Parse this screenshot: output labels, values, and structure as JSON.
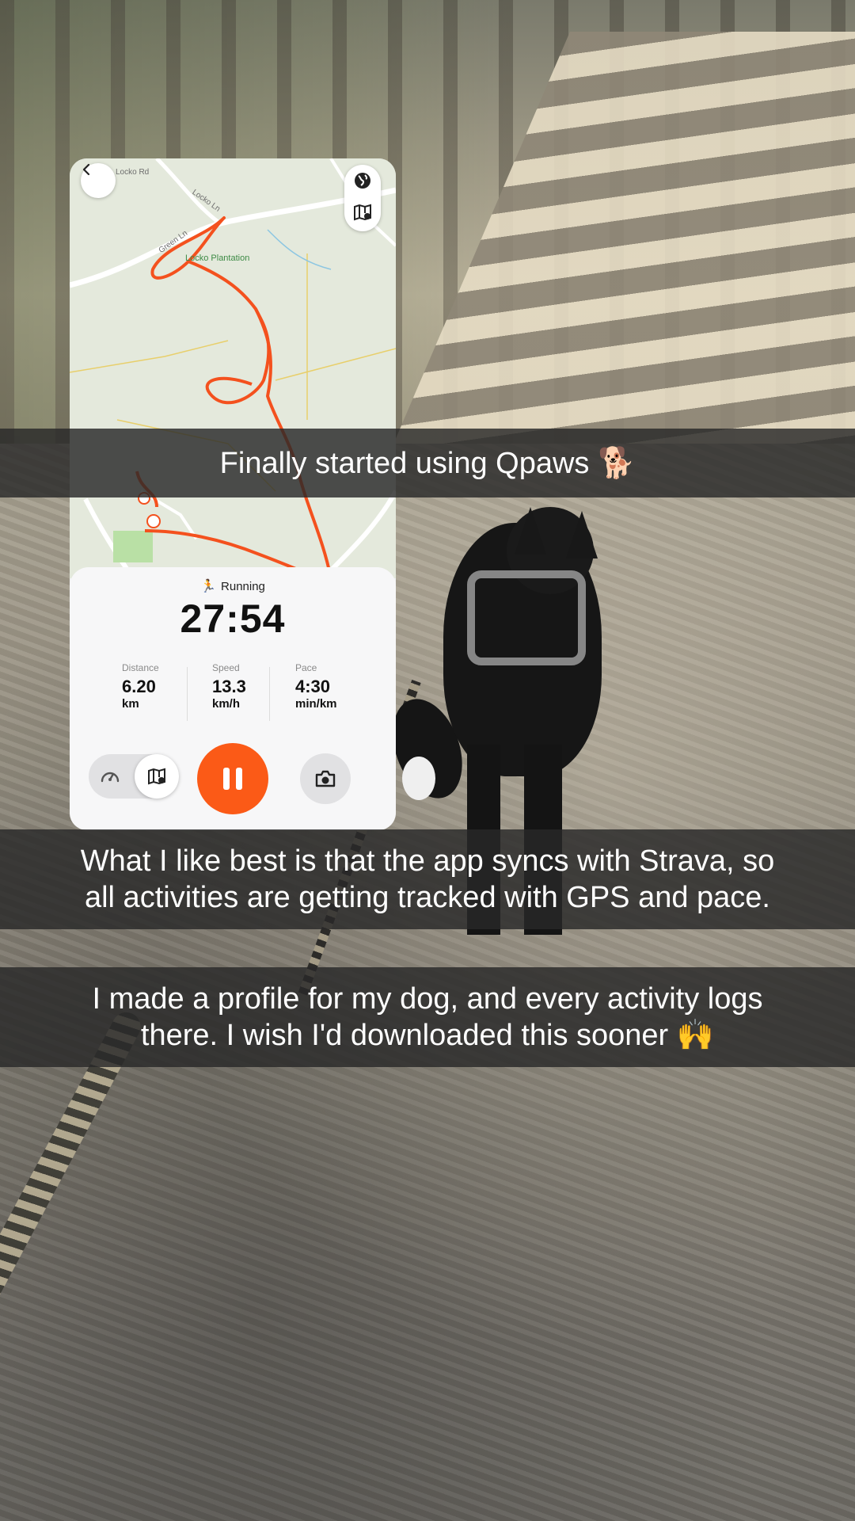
{
  "app": {
    "activity_icon": "runner-emoji",
    "activity_emoji": "🏃",
    "activity_label": "Running",
    "timer": "27:54",
    "stats": [
      {
        "label": "Distance",
        "value": "6.20",
        "unit": "km"
      },
      {
        "label": "Speed",
        "value": "13.3",
        "unit": "km/h"
      },
      {
        "label": "Pace",
        "value": "4:30",
        "unit": "min/km"
      }
    ],
    "accent_color": "#fb5a17"
  },
  "map": {
    "road_labels": [
      "Locko Rd",
      "Locko Ln",
      "Green Ln",
      "Lo"
    ],
    "poi_label": "Locko Plantation",
    "route_color": "#f4511e"
  },
  "captions": {
    "line1": "Finally started using Qpaws 🐕",
    "line2a": "What I like best is that the app syncs with Strava, so",
    "line2b": "all activities are getting tracked with GPS and pace.",
    "line3a": "I made a profile for my dog, and every activity logs",
    "line3b": "there. I wish I'd downloaded this sooner 🙌"
  }
}
